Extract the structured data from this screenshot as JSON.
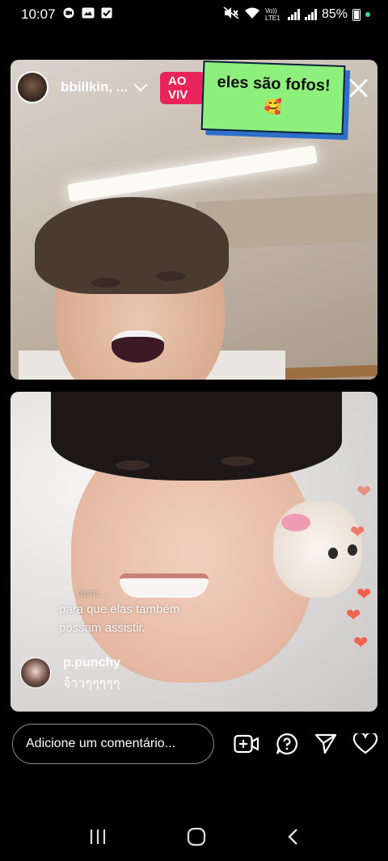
{
  "status_bar": {
    "time": "10:07",
    "network": "Vo)) LTE1",
    "battery": "85%",
    "left_icons": [
      "video-record-icon",
      "gallery-icon",
      "check-icon"
    ],
    "right_icons": [
      "mute-icon",
      "wifi-icon",
      "signal-icon",
      "battery-icon"
    ]
  },
  "live": {
    "host_name": "bbillkin, ...",
    "live_badge": "AO VIV",
    "sticker_text": "eles são fofos!",
    "sticker_emoji": "🥰"
  },
  "overlay_comments": {
    "ghost_text": "dem...",
    "faded_line1": "para que elas também",
    "faded_line2": "possam assistir."
  },
  "comment": {
    "username": "p.punchy",
    "message": "จ้าวๆๆๆๆๆ"
  },
  "bottom_bar": {
    "comment_placeholder": "Adicione um comentário...",
    "icons": [
      "add-guest-icon",
      "question-icon",
      "send-icon",
      "heart-icon"
    ]
  },
  "nav_bar": {
    "icons": [
      "recent-apps-icon",
      "home-icon",
      "back-icon"
    ]
  },
  "colors": {
    "live_badge": "#e8245a",
    "sticker_bg": "#8ef07c",
    "sticker_shadow": "#2f6fcc",
    "heart": "#f3624f"
  }
}
